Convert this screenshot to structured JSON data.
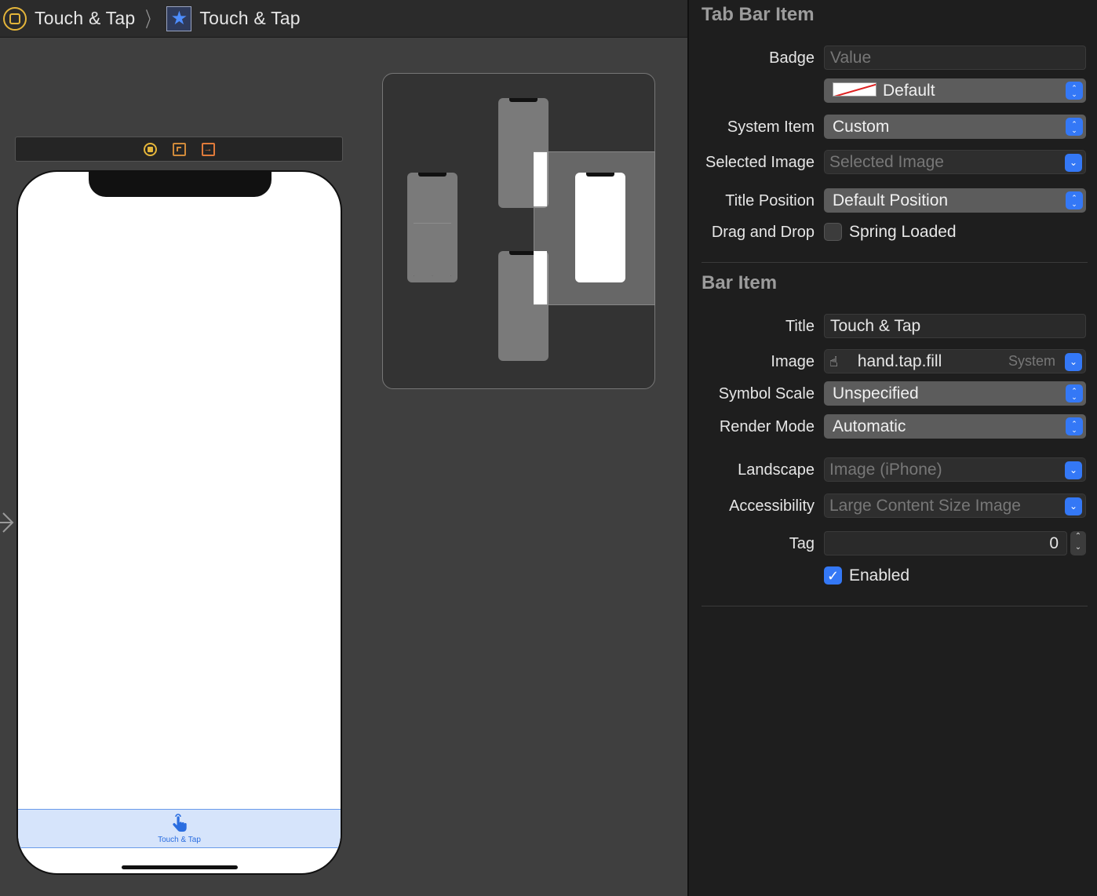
{
  "jumpbar": {
    "crumb1": "Touch & Tap",
    "separator": "〉",
    "crumb2": "Touch & Tap",
    "crumb1_icon": "view-controller-icon",
    "crumb2_icon": "star-tab-item-icon"
  },
  "scene": {
    "dock_icons": [
      "view-controller-icon",
      "first-responder-icon",
      "exit-icon"
    ],
    "tab_item_icon": "hand-tap-fill-icon",
    "tab_item_label": "Touch & Tap",
    "accent": "#2a6de0"
  },
  "inspector": {
    "tab_bar_item": {
      "title": "Tab Bar Item",
      "badge_label": "Badge",
      "badge_placeholder": "Value",
      "badge_color_value": "Default",
      "system_item_label": "System Item",
      "system_item_value": "Custom",
      "selected_image_label": "Selected Image",
      "selected_image_placeholder": "Selected Image",
      "title_position_label": "Title Position",
      "title_position_value": "Default Position",
      "drag_drop_label": "Drag and Drop",
      "spring_loaded_label": "Spring Loaded",
      "spring_loaded_checked": false
    },
    "bar_item": {
      "title": "Bar Item",
      "title_label": "Title",
      "title_value": "Touch & Tap",
      "image_label": "Image",
      "image_value": "hand.tap.fill",
      "image_source": "System",
      "symbol_scale_label": "Symbol Scale",
      "symbol_scale_value": "Unspecified",
      "render_mode_label": "Render Mode",
      "render_mode_value": "Automatic",
      "landscape_label": "Landscape",
      "landscape_placeholder": "Image (iPhone)",
      "accessibility_label": "Accessibility",
      "accessibility_placeholder": "Large Content Size Image",
      "tag_label": "Tag",
      "tag_value": "0",
      "enabled_label": "Enabled",
      "enabled_checked": true
    },
    "accent_color": "#3478f6"
  }
}
